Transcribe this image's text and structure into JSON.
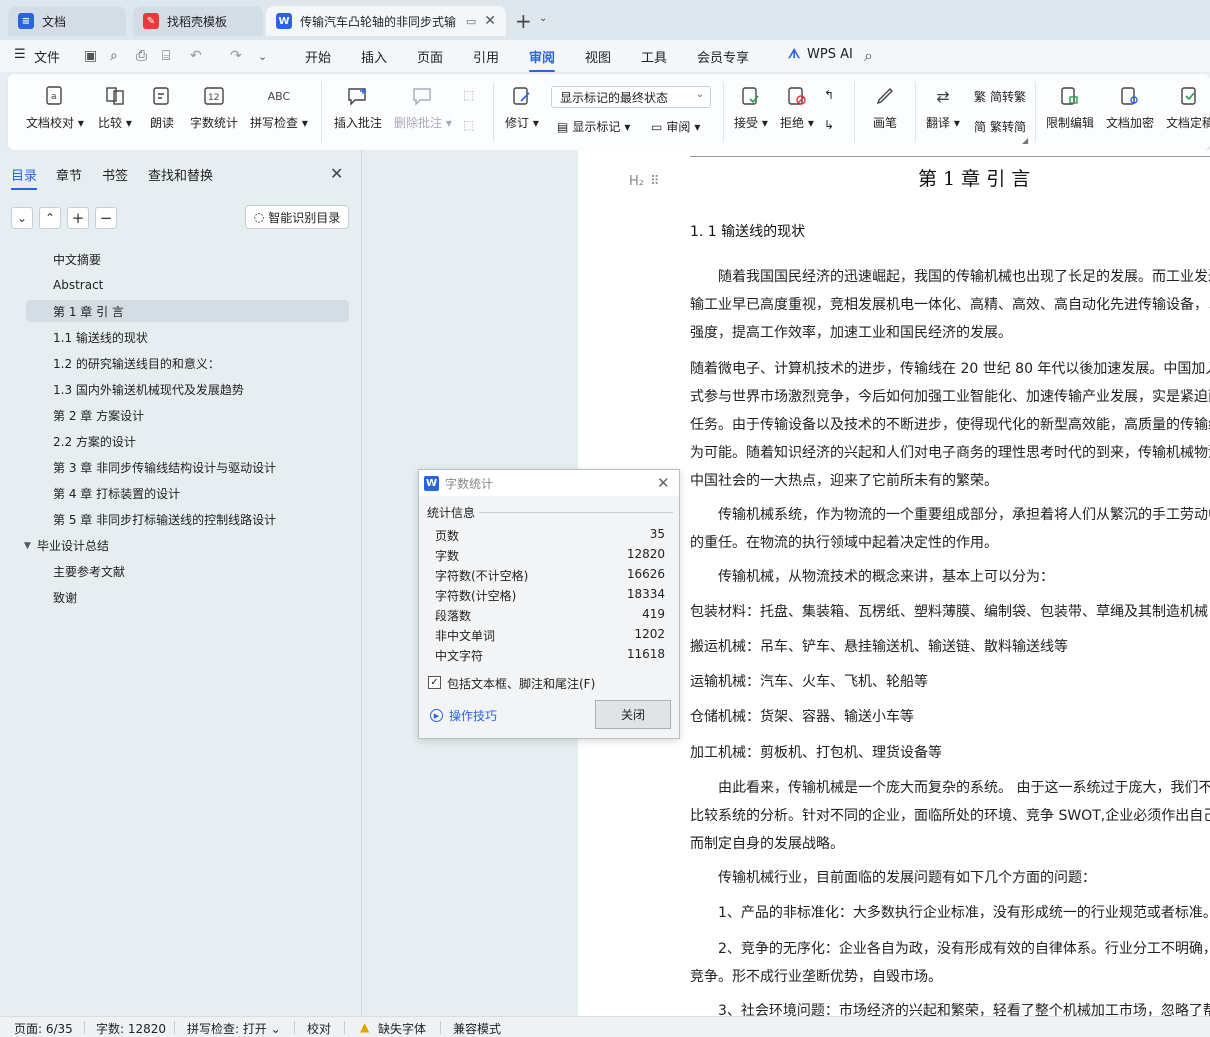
{
  "tabs": [
    {
      "title": "文档",
      "icon": "wps-docs-icon",
      "color": "#2a64e0"
    },
    {
      "title": "找稻壳模板",
      "icon": "docer-icon",
      "color": "#e83a3a"
    },
    {
      "title": "传输汽车凸轮轴的非同步式输",
      "icon": "word-doc-icon",
      "color": "#2a64e0"
    }
  ],
  "menu": {
    "file": "文件",
    "items": [
      "开始",
      "插入",
      "页面",
      "引用",
      "审阅",
      "视图",
      "工具",
      "会员专享"
    ],
    "active": "审阅",
    "wps_ai": "WPS AI"
  },
  "ribbon": {
    "doc_proofread": "文档校对",
    "compare": "比较",
    "read_aloud": "朗读",
    "word_count": "字数统计",
    "spell_check": "拼写检查",
    "insert_comment": "插入批注",
    "delete_comment": "删除批注",
    "revise": "修订",
    "display_combo": "显示标记的最终状态",
    "show_markup": "显示标记",
    "review": "审阅",
    "accept": "接受",
    "reject": "拒绝",
    "pen": "画笔",
    "translate": "翻译",
    "to_traditional": "简转繁",
    "to_simplified": "繁转简",
    "restrict_edit": "限制编辑",
    "encrypt": "文档加密",
    "doc_final": "文档定稿"
  },
  "nav": {
    "tabs": [
      "目录",
      "章节",
      "书签",
      "查找和替换"
    ],
    "smart_toc": "智能识别目录",
    "items": [
      {
        "label": "中文摘要",
        "level": 2
      },
      {
        "label": "Abstract",
        "level": 2
      },
      {
        "label": "第 1 章   引   言",
        "level": 2,
        "selected": true
      },
      {
        "label": "1.1 输送线的现状",
        "level": 2
      },
      {
        "label": "1.2 的研究输送线目的和意义：",
        "level": 2
      },
      {
        "label": "1.3  国内外输送机械现代及发展趋势",
        "level": 2
      },
      {
        "label": "第 2 章    方案设计",
        "level": 2
      },
      {
        "label": "2.2    方案的设计",
        "level": 2
      },
      {
        "label": "第 3 章  非同步传输线结构设计与驱动设计",
        "level": 2
      },
      {
        "label": "第 4 章    打标装置的设计",
        "level": 2
      },
      {
        "label": "第 5 章    非同步打标输送线的控制线路设计",
        "level": 2
      },
      {
        "label": "毕业设计总结",
        "level": 1,
        "expanded": true
      },
      {
        "label": "主要参考文献",
        "level": 2
      },
      {
        "label": "致谢",
        "level": 2
      }
    ]
  },
  "document": {
    "heading_marker": "H₂",
    "chapter_title": "第 1 章    引    言",
    "section_title": "1. 1 输送线的现状",
    "lines": [
      {
        "text": "随着我国国民经济的迅速崛起，我国的传输机械也出现了长足的发展。而工业发达",
        "indent": true
      },
      {
        "text": "输工业早已高度重视，竞相发展机电一体化、高精、高效、高自动化先进传输设备，以",
        "indent": false
      },
      {
        "text": "强度，提高工作效率，加速工业和国民经济的发展。",
        "indent": false
      },
      {
        "text": "随着微电子、计算机技术的进步，传输线在 20 世纪 80 年代以後加速发展。中国加入",
        "indent": false
      },
      {
        "text": "式参与世界市场激烈竞争，今后如何加强工业智能化、加速传输产业发展，实是紧迫而",
        "indent": false
      },
      {
        "text": "任务。由于传输设备以及技术的不断进步，使得现代化的新型高效能，高质量的传输线",
        "indent": false
      },
      {
        "text": "为可能。随着知识经济的兴起和人们对电子商务的理性思考时代的到来，传输机械物流",
        "indent": false
      },
      {
        "text": "中国社会的一大热点，迎来了它前所未有的繁荣。",
        "indent": false
      },
      {
        "text": "传输机械系统，作为物流的一个重要组成部分，承担着将人们从繁沉的手工劳动中",
        "indent": true
      },
      {
        "text": "的重任。在物流的执行领域中起着决定性的作用。",
        "indent": false
      },
      {
        "text": "传输机械，从物流技术的概念来讲，基本上可以分为：",
        "indent": true
      },
      {
        "text": "包装材料：托盘、集装箱、瓦楞纸、塑料薄膜、编制袋、包装带、草绳及其制造机械",
        "indent": false
      },
      {
        "text": "搬运机械：吊车、铲车、悬挂输送机、输送链、散料输送线等",
        "indent": false
      },
      {
        "text": "运输机械：汽车、火车、飞机、轮船等",
        "indent": false
      },
      {
        "text": "仓储机械：货架、容器、输送小车等",
        "indent": false
      },
      {
        "text": "加工机械：剪板机、打包机、理货设备等",
        "indent": false
      },
      {
        "text": "由此看来，传输机械是一个庞大而复杂的系统。  由于这一系统过于庞大，我们不",
        "indent": true
      },
      {
        "text": "比较系统的分析。针对不同的企业，面临所处的环境、竞争 SWOT,企业必须作出自己的",
        "indent": false
      },
      {
        "text": "而制定自身的发展战略。",
        "indent": false
      },
      {
        "text": "传输机械行业，目前面临的发展问题有如下几个方面的问题：",
        "indent": true
      },
      {
        "text": "1、产品的非标准化：大多数执行企业标准，没有形成统一的行业规范或者标准。",
        "indent": true
      },
      {
        "text": "2、竞争的无序化：企业各自为政，没有形成有效的自律体系。行业分工不明确，",
        "indent": true
      },
      {
        "text": "竞争。形不成行业垄断优势，自毁市场。",
        "indent": false
      },
      {
        "text": "3、社会环境问题：市场经济的兴起和繁荣，轻看了整个机械加工市场，忽略了帮",
        "indent": true
      }
    ]
  },
  "dialog": {
    "title": "字数统计",
    "group": "统计信息",
    "stats": [
      {
        "label": "页数",
        "value": "35"
      },
      {
        "label": "字数",
        "value": "12820"
      },
      {
        "label": "字符数(不计空格)",
        "value": "16626"
      },
      {
        "label": "字符数(计空格)",
        "value": "18334"
      },
      {
        "label": "段落数",
        "value": "419"
      },
      {
        "label": "非中文单词",
        "value": "1202"
      },
      {
        "label": "中文字符",
        "value": "11618"
      }
    ],
    "include_label": "包括文本框、脚注和尾注(F)",
    "include_checked": true,
    "tips": "操作技巧",
    "close": "关闭"
  },
  "status": {
    "page": "页面: 6/35",
    "words": "字数: 12820",
    "spell": "拼写检查: 打开",
    "proof": "校对",
    "missing_font": "缺失字体",
    "compat": "兼容模式"
  }
}
